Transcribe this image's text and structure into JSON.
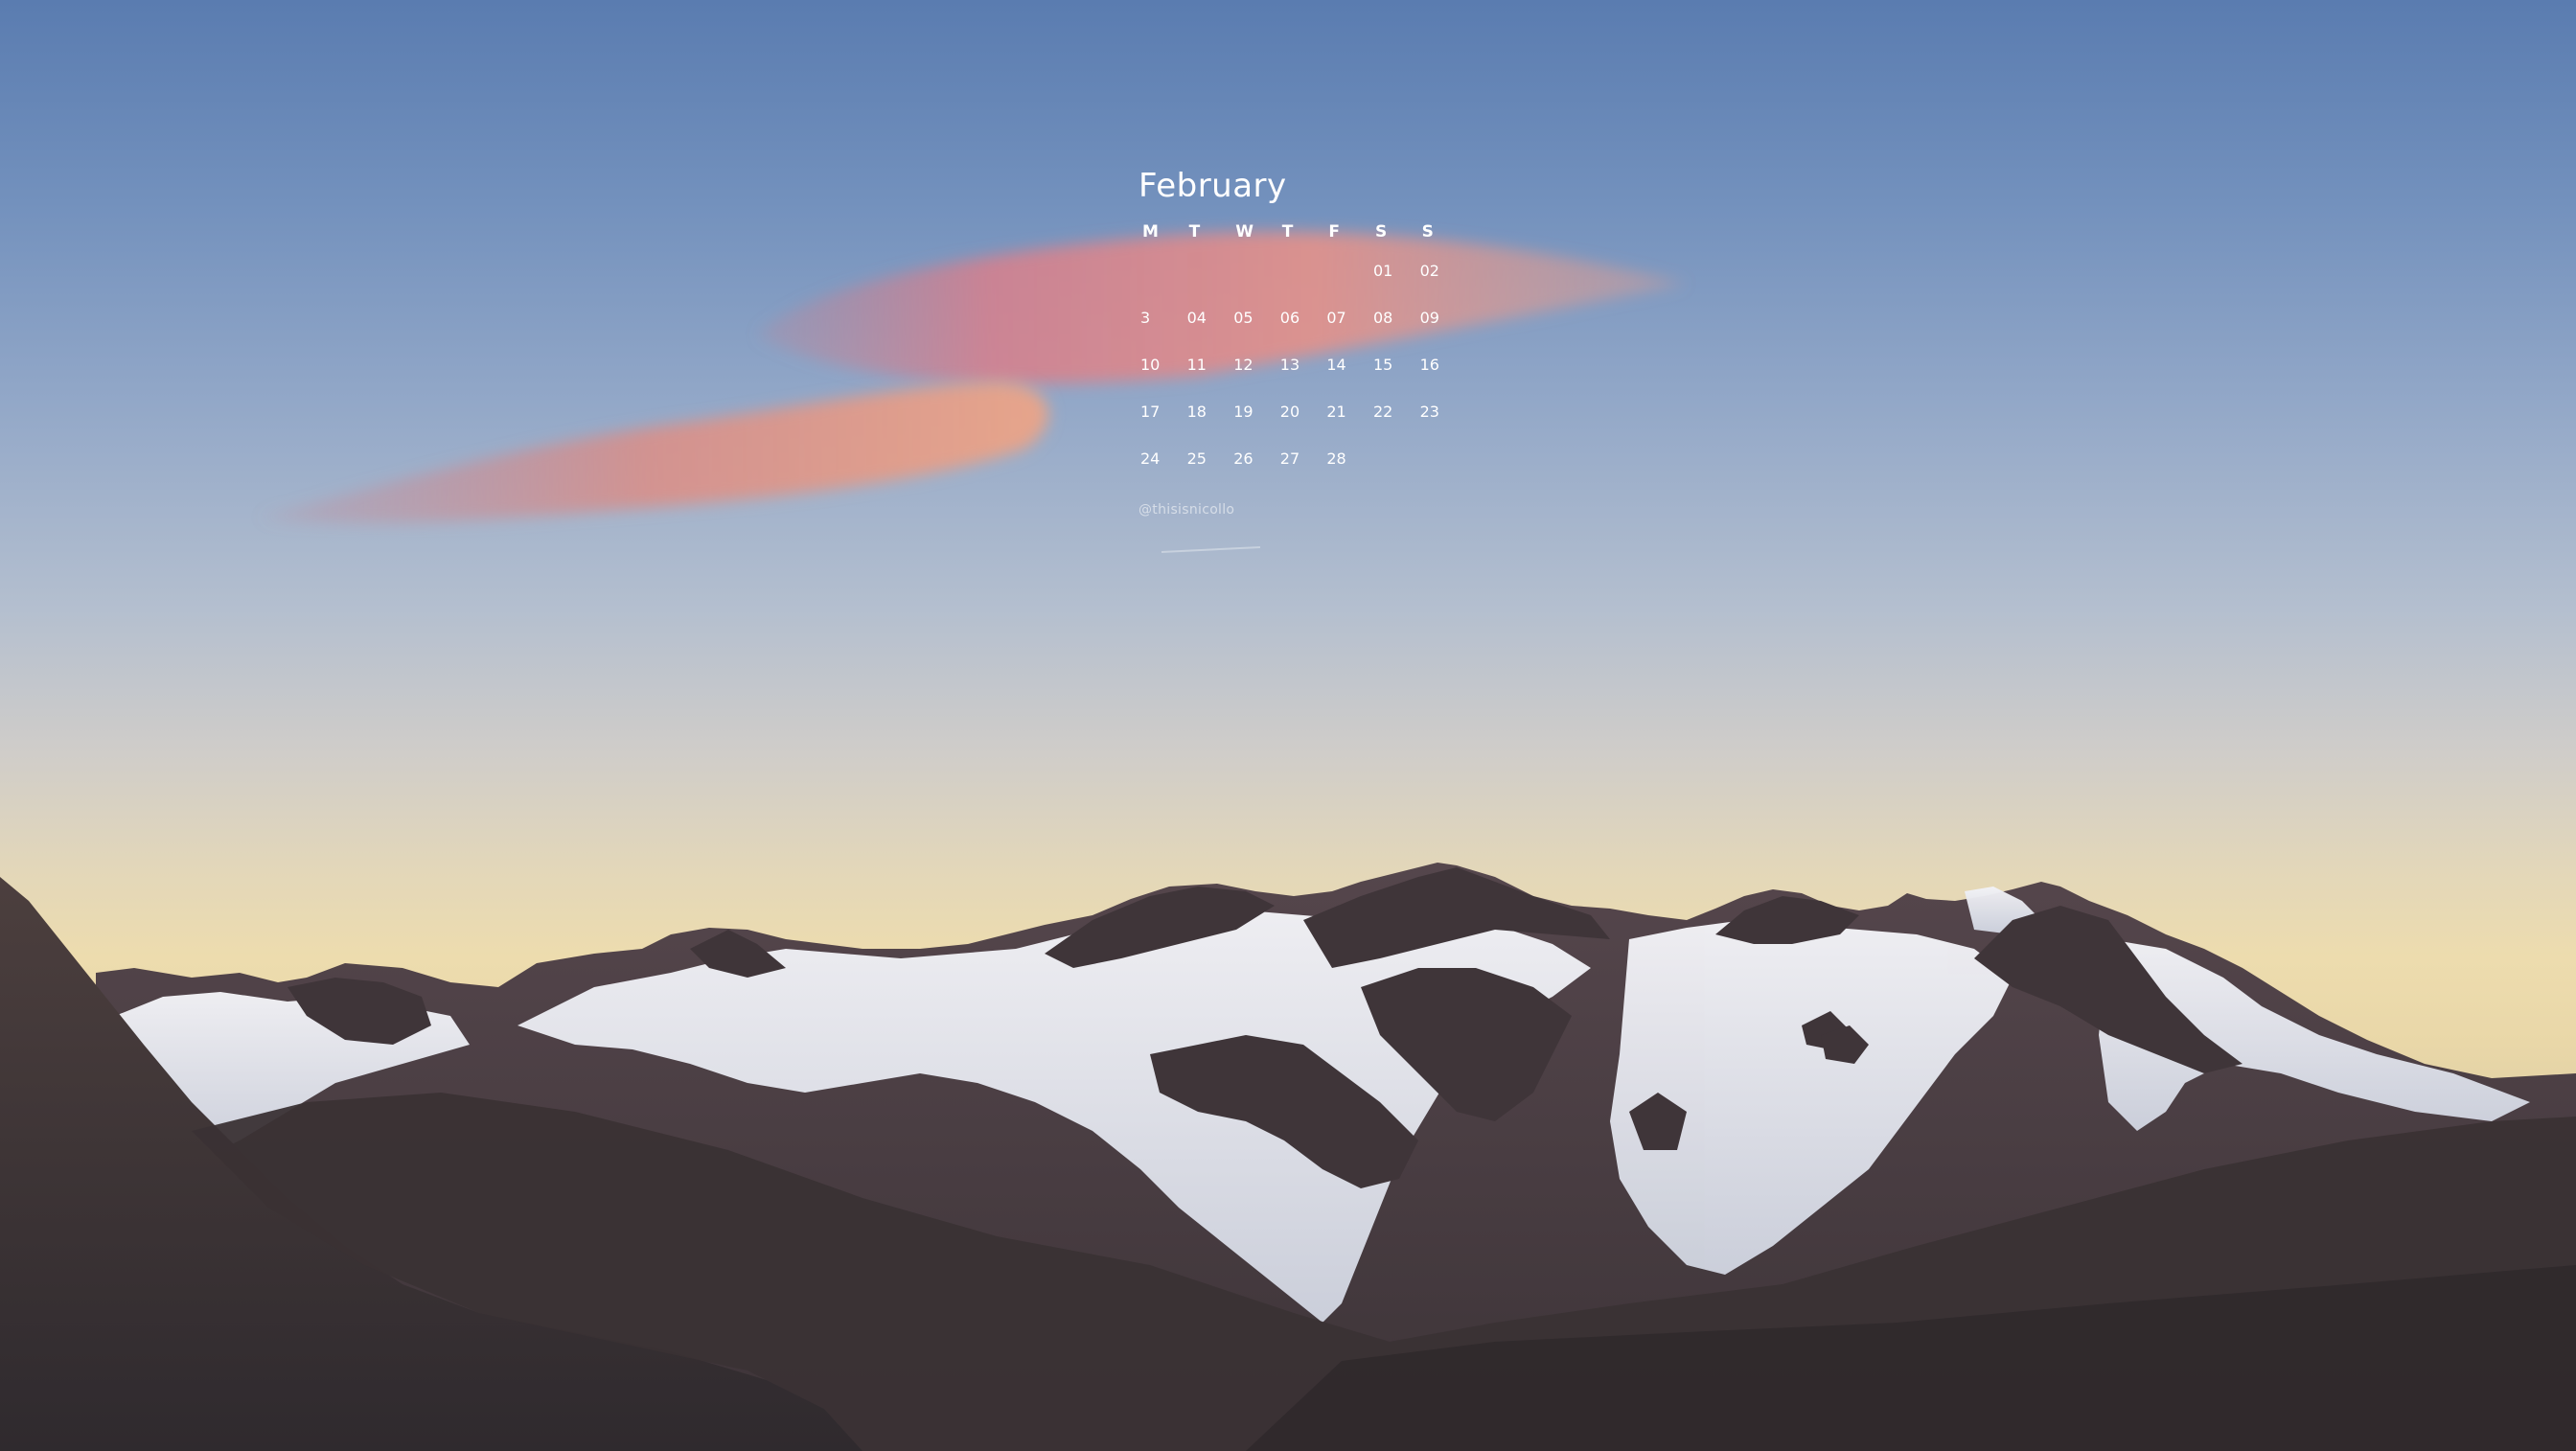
{
  "calendar": {
    "month": "February",
    "weekdays": [
      "M",
      "T",
      "W",
      "T",
      "F",
      "S",
      "S"
    ],
    "weeks": [
      [
        "",
        "",
        "",
        "",
        "",
        "01",
        "02"
      ],
      [
        "3",
        "04",
        "05",
        "06",
        "07",
        "08",
        "09"
      ],
      [
        "10",
        "11",
        "12",
        "13",
        "14",
        "15",
        "16"
      ],
      [
        "17",
        "18",
        "19",
        "20",
        "21",
        "22",
        "23"
      ],
      [
        "24",
        "25",
        "26",
        "27",
        "28",
        "",
        ""
      ]
    ],
    "credit": "@thisisnicollo"
  },
  "scene": {
    "sky_top": "#5a7cb0",
    "horizon": "#eddcae",
    "cloud_color": "#d98a8a",
    "snow_color": "#e9ebf2",
    "rock_color": "#4a3e42"
  }
}
